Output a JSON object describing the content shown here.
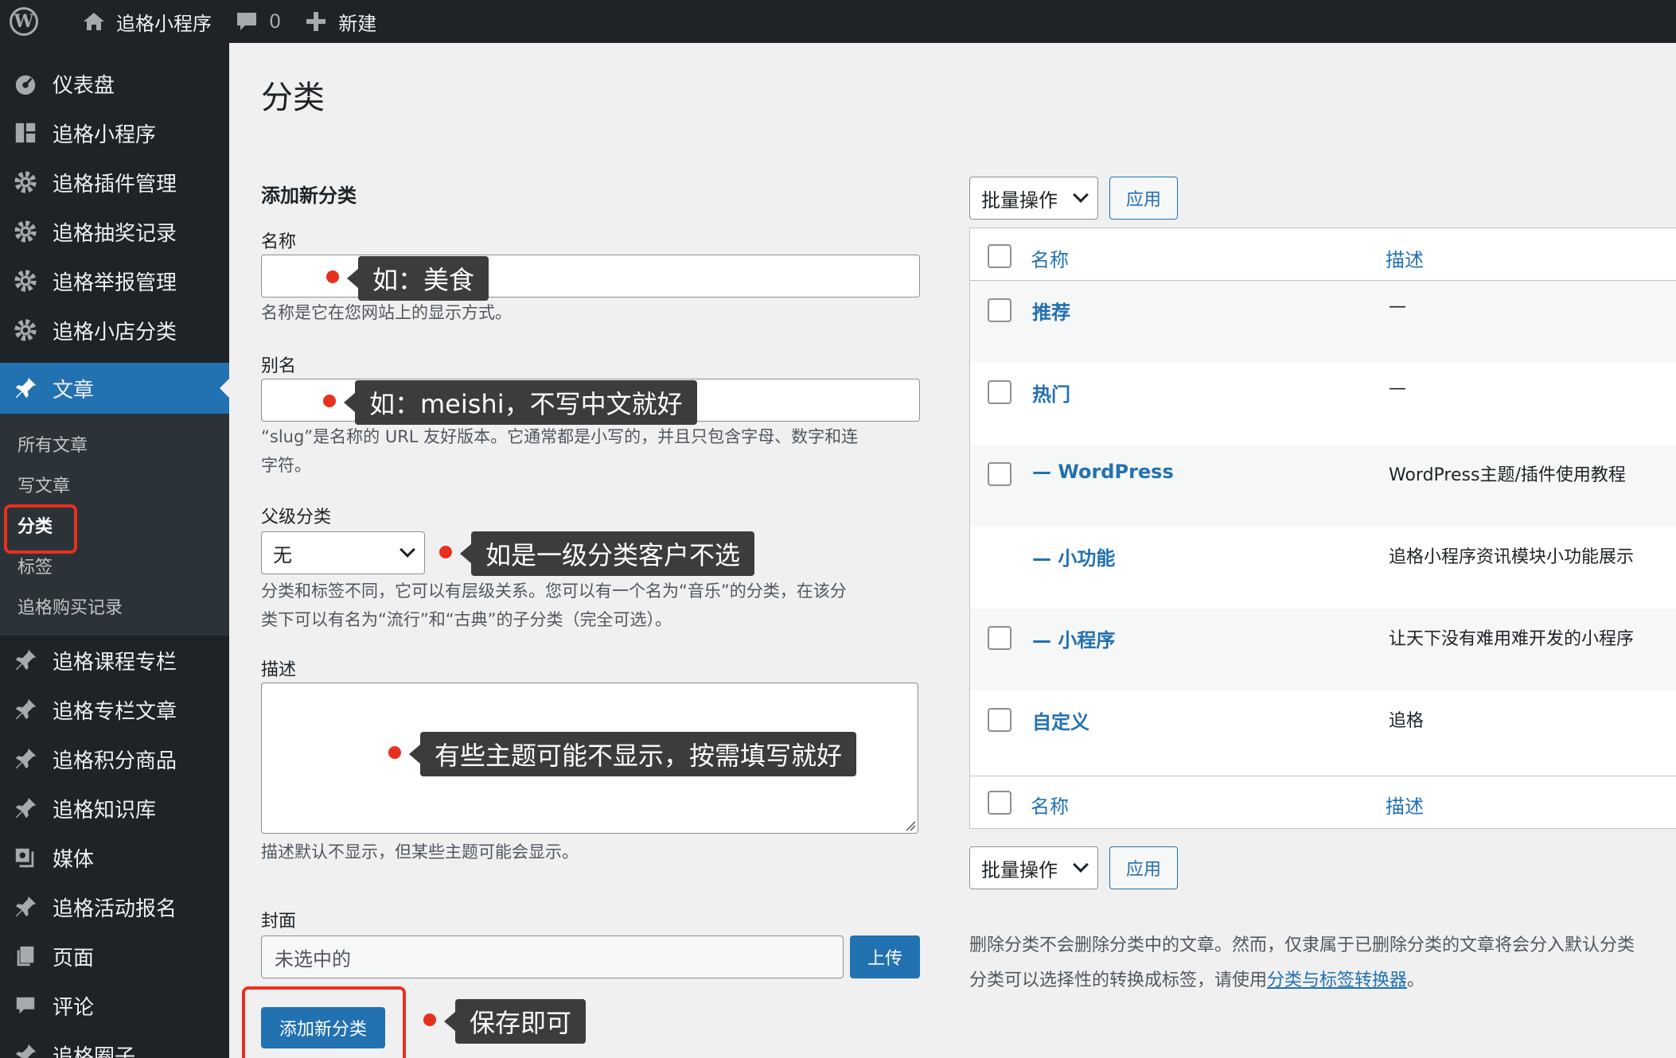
{
  "admin_bar": {
    "site_name": "追格小程序",
    "comments_count": "0",
    "new_label": "新建"
  },
  "sidebar": {
    "items_top": [
      {
        "label": "仪表盘",
        "icon": "dashboard-icon"
      },
      {
        "label": "追格小程序",
        "icon": "grid-icon"
      },
      {
        "label": "追格插件管理",
        "icon": "gear-icon"
      },
      {
        "label": "追格抽奖记录",
        "icon": "gear-icon"
      },
      {
        "label": "追格举报管理",
        "icon": "gear-icon"
      },
      {
        "label": "追格小店分类",
        "icon": "gear-icon"
      }
    ],
    "active": {
      "label": "文章",
      "icon": "pin-icon"
    },
    "submenu": [
      "所有文章",
      "写文章",
      "分类",
      "标签",
      "追格购买记录"
    ],
    "items_bottom": [
      {
        "label": "追格课程专栏",
        "icon": "pin-icon"
      },
      {
        "label": "追格专栏文章",
        "icon": "pin-icon"
      },
      {
        "label": "追格积分商品",
        "icon": "pin-icon"
      },
      {
        "label": "追格知识库",
        "icon": "pin-icon"
      },
      {
        "label": "媒体",
        "icon": "media-icon"
      },
      {
        "label": "追格活动报名",
        "icon": "pin-icon"
      },
      {
        "label": "页面",
        "icon": "page-icon"
      },
      {
        "label": "评论",
        "icon": "comment-icon"
      },
      {
        "label": "追格圈子",
        "icon": "pin-icon"
      }
    ]
  },
  "page": {
    "title": "分类",
    "form": {
      "heading": "添加新分类",
      "name_label": "名称",
      "name_help": "名称是它在您网站上的显示方式。",
      "slug_label": "别名",
      "slug_help_1": "“slug”是名称的 URL 友好版本。它通常都是小写的，并且只包含字母、数字和连",
      "slug_help_2": "字符。",
      "parent_label": "父级分类",
      "parent_value": "无",
      "parent_help_1": "分类和标签不同，它可以有层级关系。您可以有一个名为“音乐”的分类，在该分",
      "parent_help_2": "类下可以有名为“流行”和“古典”的子分类（完全可选）。",
      "desc_label": "描述",
      "desc_help": "描述默认不显示，但某些主题可能会显示。",
      "cover_label": "封面",
      "cover_placeholder": "未选中的",
      "upload_button": "上传",
      "submit_button": "添加新分类"
    },
    "annotations": {
      "name": "如：美食",
      "slug": "如：meishi，不写中文就好",
      "parent": "如是一级分类客户不选",
      "desc": "有些主题可能不显示，按需填写就好",
      "save": "保存即可"
    },
    "table": {
      "bulk_label": "批量操作",
      "apply_label": "应用",
      "col_name": "名称",
      "col_desc": "描述",
      "rows": [
        {
          "name": "推荐",
          "desc": "—",
          "checkbox": true
        },
        {
          "name": "热门",
          "desc": "—",
          "checkbox": true
        },
        {
          "name": "— WordPress",
          "desc": "WordPress主题/插件使用教程",
          "checkbox": true
        },
        {
          "name": "— 小功能",
          "desc": "追格小程序资讯模块小功能展示",
          "checkbox": false
        },
        {
          "name": "— 小程序",
          "desc": "让天下没有难用难开发的小程序",
          "checkbox": true
        },
        {
          "name": "自定义",
          "desc": "追格",
          "checkbox": true
        }
      ]
    },
    "footer": {
      "note1": "删除分类不会删除分类中的文章。然而，仅隶属于已删除分类的文章将会分入默认分类",
      "note2_pre": "分类可以选择性的转换成标签，请使用",
      "note2_link": "分类与标签转换器",
      "note2_post": "。"
    }
  },
  "colors": {
    "admin_dark": "#1d2327",
    "accent": "#2271b1",
    "annotation_red": "#e8301e",
    "tooltip_bg": "#3c3c3c"
  }
}
